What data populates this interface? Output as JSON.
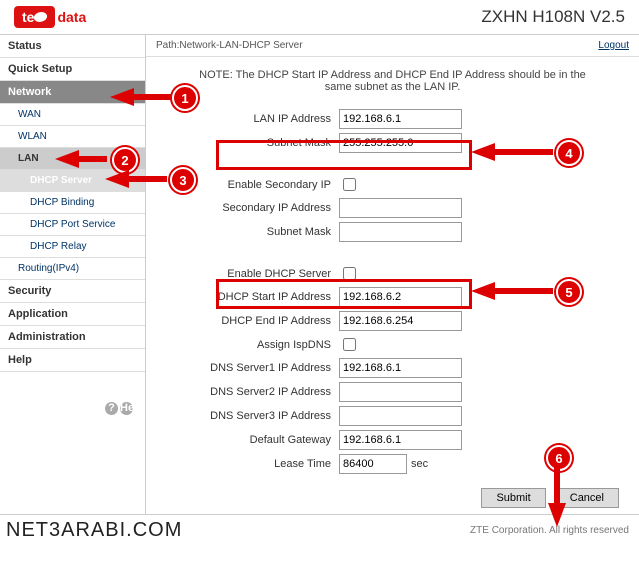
{
  "header": {
    "logo_brand": "te",
    "logo_suffix": "data",
    "model": "ZXHN H108N V2.5"
  },
  "sidebar": {
    "status": "Status",
    "quick": "Quick Setup",
    "network": "Network",
    "wan": "WAN",
    "wlan": "WLAN",
    "lan": "LAN",
    "dhcp_server": "DHCP Server",
    "dhcp_binding": "DHCP Binding",
    "dhcp_port": "DHCP Port Service",
    "dhcp_relay": "DHCP Relay",
    "routing": "Routing(IPv4)",
    "security": "Security",
    "application": "Application",
    "admin": "Administration",
    "help": "Help",
    "help_icon_label": "Help"
  },
  "path": {
    "label": "Path:Network-LAN-DHCP Server",
    "logout": "Logout"
  },
  "note": "NOTE: The DHCP Start IP Address and DHCP End IP Address should be in the same subnet as the LAN IP.",
  "form": {
    "lan_ip": {
      "label": "LAN IP Address",
      "value": "192.168.6.1"
    },
    "subnet": {
      "label": "Subnet Mask",
      "value": "255.255.255.0"
    },
    "en_sec": {
      "label": "Enable Secondary IP"
    },
    "sec_ip": {
      "label": "Secondary IP Address",
      "value": ""
    },
    "sec_subnet": {
      "label": "Subnet Mask",
      "value": ""
    },
    "en_dhcp": {
      "label": "Enable DHCP Server"
    },
    "start": {
      "label": "DHCP Start IP Address",
      "value": "192.168.6.2"
    },
    "end": {
      "label": "DHCP End IP Address",
      "value": "192.168.6.254"
    },
    "assign": {
      "label": "Assign IspDNS"
    },
    "dns1": {
      "label": "DNS Server1 IP Address",
      "value": "192.168.6.1"
    },
    "dns2": {
      "label": "DNS Server2 IP Address",
      "value": ""
    },
    "dns3": {
      "label": "DNS Server3 IP Address",
      "value": ""
    },
    "gw": {
      "label": "Default Gateway",
      "value": "192.168.6.1"
    },
    "lease": {
      "label": "Lease Time",
      "value": "86400",
      "unit": "sec"
    }
  },
  "buttons": {
    "submit": "Submit",
    "cancel": "Cancel"
  },
  "footer": {
    "watermark": "NET3ARABI.COM",
    "copy": "ZTE Corporation. All rights reserved"
  },
  "annot": {
    "1": "1",
    "2": "2",
    "3": "3",
    "4": "4",
    "5": "5",
    "6": "6"
  }
}
